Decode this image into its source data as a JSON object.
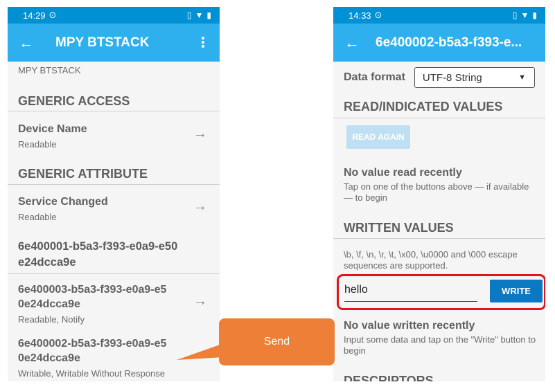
{
  "left": {
    "status": {
      "time": "14:29"
    },
    "appbar": {
      "title": "MPY BTSTACK"
    },
    "device_subtitle": "MPY BTSTACK",
    "sections": [
      {
        "header": "GENERIC ACCESS"
      },
      {
        "header": "GENERIC ATTRIBUTE"
      }
    ],
    "characteristics": [
      {
        "name": "Device Name",
        "props": "Readable"
      },
      {
        "name": "Service Changed",
        "props": "Readable"
      }
    ],
    "service_uuid": [
      "6e400001-b5a3-f393-e0a9-e50",
      "e24dcca9e"
    ],
    "char3": {
      "name": [
        "6e400003-b5a3-f393-e0a9-e5",
        "0e24dcca9e"
      ],
      "props": "Readable, Notify"
    },
    "char2": {
      "name": [
        "6e400002-b5a3-f393-e0a9-e5",
        "0e24dcca9e"
      ],
      "props": "Writable, Writable Without Response"
    }
  },
  "right": {
    "status": {
      "time": "14:33"
    },
    "appbar": {
      "title": "6e400002-b5a3-f393-e..."
    },
    "data_format_label": "Data format",
    "data_format_value": "UTF-8 String",
    "read_header": "READ/INDICATED VALUES",
    "read_again_label": "READ AGAIN",
    "no_read_title": "No value read recently",
    "no_read_desc": "Tap on one of the buttons above — if available — to begin",
    "written_header": "WRITTEN VALUES",
    "escape_note": "\\b, \\f, \\n, \\r, \\t, \\x00, \\u0000 and \\000 escape sequences are supported.",
    "write_input_value": "hello",
    "write_label": "WRITE",
    "no_write_title": "No value written recently",
    "no_write_desc": "Input some data and tap on the \"Write\" button to begin",
    "descriptors_header": "DESCRIPTORS"
  },
  "callout": {
    "text": "Send"
  },
  "colors": {
    "appbar": "#2eb0ee",
    "statusbar": "#0091d5",
    "write_button": "#0a78c2",
    "highlight": "#e0141a",
    "callout": "#ee7f36"
  }
}
